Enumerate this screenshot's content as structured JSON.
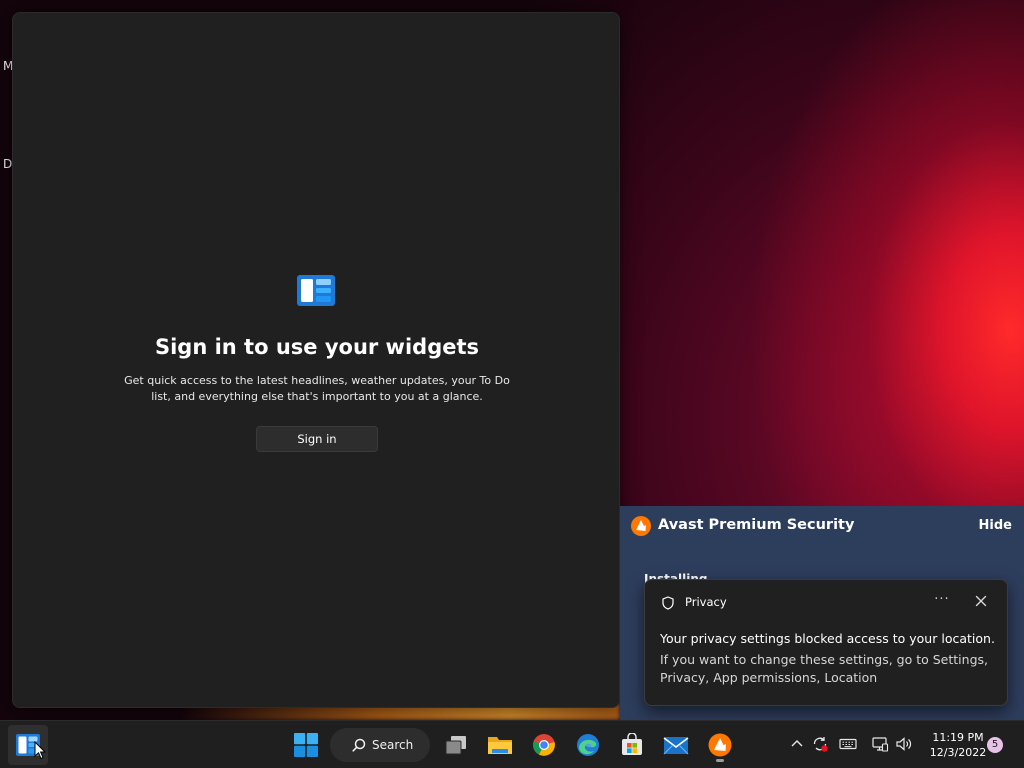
{
  "desktop": {
    "letter_top": "M",
    "letter_bottom": "D"
  },
  "widgets_panel": {
    "title": "Sign in to use your widgets",
    "description": "Get quick access to the latest headlines, weather updates, your To Do list, and everything else that's important to you at a glance.",
    "sign_in_label": "Sign in"
  },
  "avast": {
    "title": "Avast Premium Security",
    "hide_label": "Hide",
    "status": "Installing..."
  },
  "privacy_toast": {
    "app_name": "Privacy",
    "more_label": "···",
    "message_title": "Your privacy settings blocked access to your location.",
    "message_body": "If you want to change these settings, go to Settings, Privacy, App permissions, Location"
  },
  "taskbar": {
    "search_label": "Search",
    "icons": [
      "widgets-icon",
      "start-icon",
      "search-icon",
      "task-view-icon",
      "file-explorer-icon",
      "chrome-icon",
      "edge-icon",
      "microsoft-store-icon",
      "mail-icon",
      "avast-icon"
    ]
  },
  "tray": {
    "time": "11:19 PM",
    "date": "12/3/2022",
    "notification_count": "5",
    "icons": [
      "chevron-up-icon",
      "sync-icon",
      "keyboard-icon",
      "network-icon",
      "volume-icon"
    ]
  },
  "colors": {
    "panel_bg": "#202020",
    "avast_bg": "#2d3d5c",
    "avast_orange": "#ff7800",
    "widgets_blue": "#1f79d6"
  }
}
